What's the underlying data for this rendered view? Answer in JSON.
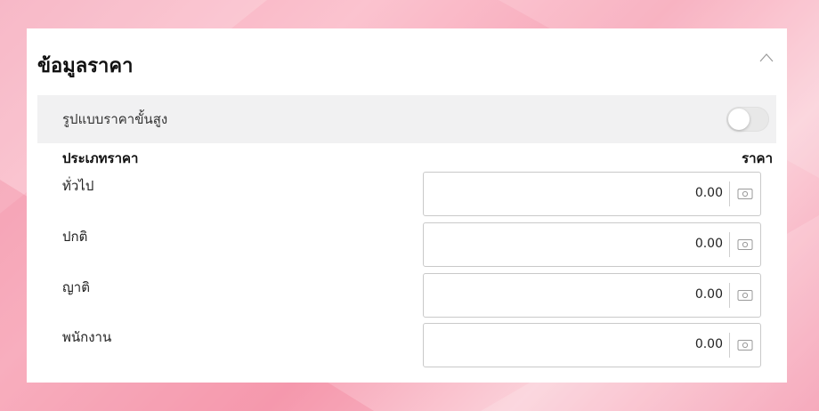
{
  "panel": {
    "title": "ข้อมูลราคา",
    "collapse_icon": "chevron-up-icon"
  },
  "advanced": {
    "label": "รูปแบบราคาขั้นสูง",
    "toggle_on": false
  },
  "columns": {
    "type_header": "ประเภทราคา",
    "price_header": "ราคา"
  },
  "price_rows": [
    {
      "label": "ทั่วไป",
      "value": "0.00",
      "icon": "money-icon"
    },
    {
      "label": "ปกติ",
      "value": "0.00",
      "icon": "money-icon"
    },
    {
      "label": "ญาติ",
      "value": "0.00",
      "icon": "money-icon"
    },
    {
      "label": "พนักงาน",
      "value": "0.00",
      "icon": "money-icon"
    }
  ],
  "colors": {
    "panel_bg": "#ffffff",
    "row_bg": "#f1f1f2",
    "border": "#c9c9c9",
    "background_accent": "#f6a9bb"
  }
}
